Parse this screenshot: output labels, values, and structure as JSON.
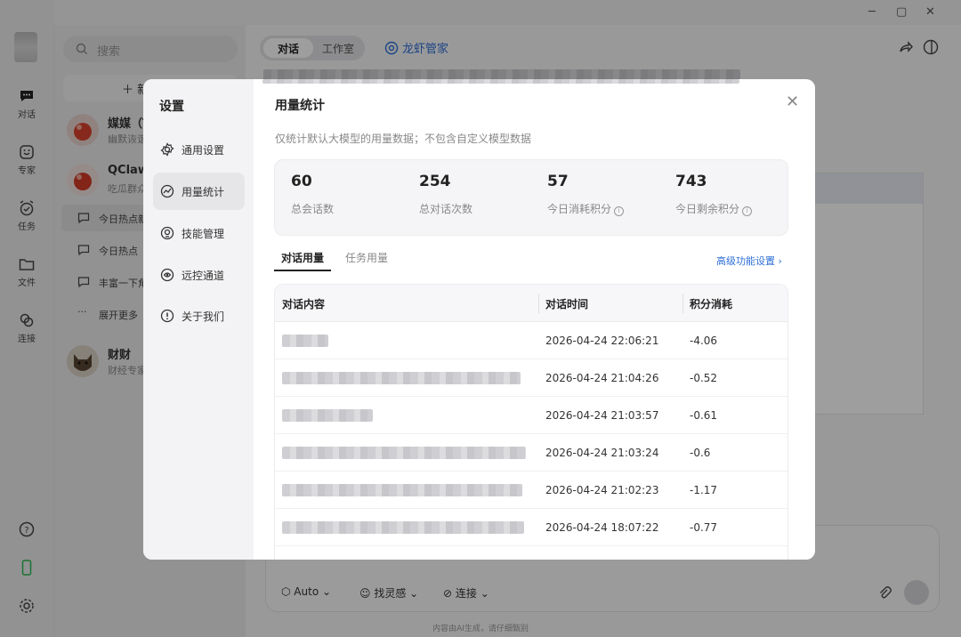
{
  "window_controls": {
    "minimize": "─",
    "maximize": "▢",
    "close": "✕"
  },
  "rail": {
    "items": [
      {
        "label": "对话",
        "icon": "chat-bubble-icon"
      },
      {
        "label": "专家",
        "icon": "expert-smiley-icon"
      },
      {
        "label": "任务",
        "icon": "task-clock-icon"
      },
      {
        "label": "文件",
        "icon": "folder-icon"
      },
      {
        "label": "连接",
        "icon": "link-icon"
      }
    ],
    "bottom_icons": [
      "help-icon",
      "phone-icon",
      "gear-icon"
    ]
  },
  "sidebar": {
    "search_placeholder": "搜索",
    "new_label": "新",
    "chats": [
      {
        "name": "媒媒（T",
        "subtitle": "幽默诙谐"
      },
      {
        "name": "QClaw",
        "subtitle": "吃瓜群众"
      }
    ],
    "subitems": [
      "今日热点新",
      "今日热点",
      "丰富一下角"
    ],
    "expand_label": "展开更多",
    "bottom_chat": {
      "name": "财财",
      "subtitle": "财经专家"
    }
  },
  "main": {
    "tabs": [
      "对话",
      "工作室"
    ],
    "agent_name": "龙虾管家",
    "input_toolbar": {
      "auto": "Auto",
      "inspire": "找灵感",
      "connect": "连接"
    },
    "footnote": "内容由AI生成，请仔细甄别"
  },
  "modal": {
    "sidebar_title": "设置",
    "nav": [
      {
        "label": "通用设置",
        "icon": "settings-gear-icon"
      },
      {
        "label": "用量统计",
        "icon": "usage-chart-icon"
      },
      {
        "label": "技能管理",
        "icon": "skills-icon"
      },
      {
        "label": "远控通道",
        "icon": "remote-channel-icon"
      },
      {
        "label": "关于我们",
        "icon": "info-icon"
      }
    ],
    "active_nav": "用量统计",
    "title": "用量统计",
    "close_label": "✕",
    "description": "仅统计默认大模型的用量数据；不包含自定义模型数据",
    "stats": [
      {
        "value": "60",
        "label": "总会话数"
      },
      {
        "value": "254",
        "label": "总对话次数"
      },
      {
        "value": "57",
        "label": "今日消耗积分"
      },
      {
        "value": "743",
        "label": "今日剩余积分"
      }
    ],
    "tabs": [
      "对话用量",
      "任务用量"
    ],
    "advanced_link": "高级功能设置 ›",
    "table": {
      "headers": [
        "对话内容",
        "对话时间",
        "积分消耗"
      ],
      "rows": [
        {
          "time": "2026-04-24 22:06:21",
          "points": "-4.06"
        },
        {
          "time": "2026-04-24 21:04:26",
          "points": "-0.52"
        },
        {
          "time": "2026-04-24 21:03:57",
          "points": "-0.61"
        },
        {
          "time": "2026-04-24 21:03:24",
          "points": "-0.6"
        },
        {
          "time": "2026-04-24 21:02:23",
          "points": "-1.17"
        },
        {
          "time": "2026-04-24 18:07:22",
          "points": "-0.77"
        }
      ]
    }
  }
}
